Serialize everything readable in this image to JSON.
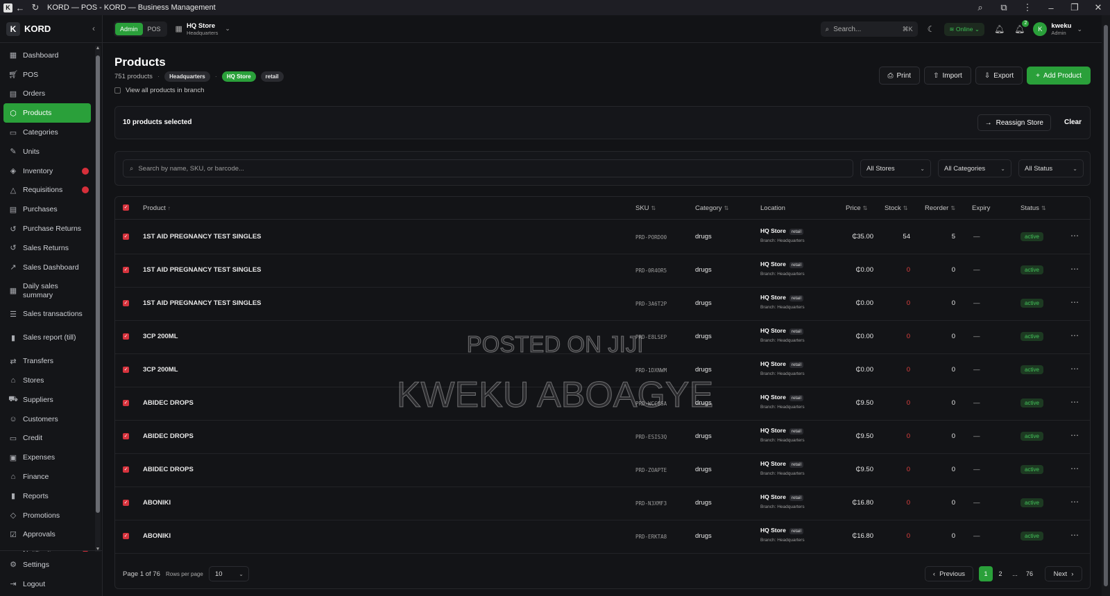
{
  "window": {
    "title": "KORD — POS - KORD — Business Management"
  },
  "brand": {
    "name": "KORD",
    "logo_letter": "K"
  },
  "sidebar": {
    "items": [
      {
        "label": "Dashboard",
        "icon": "grid-icon"
      },
      {
        "label": "POS",
        "icon": "cart-icon"
      },
      {
        "label": "Orders",
        "icon": "clipboard-icon"
      },
      {
        "label": "Products",
        "icon": "box-icon",
        "active": true
      },
      {
        "label": "Categories",
        "icon": "folder-icon"
      },
      {
        "label": "Units",
        "icon": "ruler-icon"
      },
      {
        "label": "Inventory",
        "icon": "layers-icon",
        "badge": true
      },
      {
        "label": "Requisitions",
        "icon": "alert-icon",
        "badge": true
      },
      {
        "label": "Purchases",
        "icon": "receipt-icon"
      },
      {
        "label": "Purchase Returns",
        "icon": "return-icon"
      },
      {
        "label": "Sales Returns",
        "icon": "return-icon"
      },
      {
        "label": "Sales Dashboard",
        "icon": "trend-icon"
      },
      {
        "label": "Daily sales summary",
        "icon": "calendar-icon"
      },
      {
        "label": "Sales transactions",
        "icon": "list-icon"
      },
      {
        "label": "Sales report (till)",
        "icon": "bar-chart-icon"
      },
      {
        "label": "Transfers",
        "icon": "swap-icon"
      },
      {
        "label": "Stores",
        "icon": "store-icon"
      },
      {
        "label": "Suppliers",
        "icon": "truck-icon"
      },
      {
        "label": "Customers",
        "icon": "users-icon"
      },
      {
        "label": "Credit",
        "icon": "card-icon"
      },
      {
        "label": "Expenses",
        "icon": "wallet-icon"
      },
      {
        "label": "Finance",
        "icon": "bank-icon"
      },
      {
        "label": "Reports",
        "icon": "bar-chart-icon"
      },
      {
        "label": "Promotions",
        "icon": "tag-icon"
      },
      {
        "label": "Approvals",
        "icon": "check-icon"
      },
      {
        "label": "Notifications",
        "icon": "bell-icon",
        "badge": true
      }
    ],
    "bottom": [
      {
        "label": "Settings",
        "icon": "gear-icon"
      },
      {
        "label": "Logout",
        "icon": "logout-icon"
      }
    ]
  },
  "header": {
    "mode_admin": "Admin",
    "mode_pos": "POS",
    "store_name": "HQ Store",
    "store_sub": "Headquarters",
    "search_placeholder": "Search...",
    "search_kbd": "⌘K",
    "online_label": "Online",
    "notif_count": "2",
    "user_initial": "K",
    "user_name": "kweku",
    "user_role": "Admin"
  },
  "page": {
    "title": "Products",
    "count_text": "751 products",
    "chip_branch": "Headquarters",
    "chip_store": "HQ Store",
    "chip_type": "retail",
    "view_all_label": "View all products in branch",
    "actions": {
      "print": "Print",
      "import": "Import",
      "export": "Export",
      "add": "Add Product"
    }
  },
  "selection": {
    "text": "10 products selected",
    "reassign": "Reassign Store",
    "clear": "Clear"
  },
  "filters": {
    "search_placeholder": "Search by name, SKU, or barcode...",
    "stores": "All Stores",
    "categories": "All Categories",
    "status": "All Status"
  },
  "table": {
    "headers": {
      "product": "Product",
      "sku": "SKU",
      "category": "Category",
      "location": "Location",
      "price": "Price",
      "stock": "Stock",
      "reorder": "Reorder",
      "expiry": "Expiry",
      "status": "Status"
    },
    "rows": [
      {
        "product": "1ST AID PREGNANCY TEST SINGLES",
        "sku": "PRD-PORDO0",
        "category": "drugs",
        "loc": "HQ Store",
        "tag": "retail",
        "branch": "Branch: Headquarters",
        "price": "₵35.00",
        "stock": "54",
        "reorder": "5",
        "expiry": "—",
        "status": "active"
      },
      {
        "product": "1ST AID PREGNANCY TEST SINGLES",
        "sku": "PRD-0R4OR5",
        "category": "drugs",
        "loc": "HQ Store",
        "tag": "retail",
        "branch": "Branch: Headquarters",
        "price": "₵0.00",
        "stock": "0",
        "reorder": "0",
        "expiry": "—",
        "status": "active"
      },
      {
        "product": "1ST AID PREGNANCY TEST SINGLES",
        "sku": "PRD-3A6T2P",
        "category": "drugs",
        "loc": "HQ Store",
        "tag": "retail",
        "branch": "Branch: Headquarters",
        "price": "₵0.00",
        "stock": "0",
        "reorder": "0",
        "expiry": "—",
        "status": "active"
      },
      {
        "product": "3CP 200ML",
        "sku": "PRD-E8LSEP",
        "category": "drugs",
        "loc": "HQ Store",
        "tag": "retail",
        "branch": "Branch: Headquarters",
        "price": "₵0.00",
        "stock": "0",
        "reorder": "0",
        "expiry": "—",
        "status": "active"
      },
      {
        "product": "3CP 200ML",
        "sku": "PRD-1DXNWM",
        "category": "drugs",
        "loc": "HQ Store",
        "tag": "retail",
        "branch": "Branch: Headquarters",
        "price": "₵0.00",
        "stock": "0",
        "reorder": "0",
        "expiry": "—",
        "status": "active"
      },
      {
        "product": "ABIDEC DROPS",
        "sku": "PRD-WCC8SA",
        "category": "drugs",
        "loc": "HQ Store",
        "tag": "retail",
        "branch": "Branch: Headquarters",
        "price": "₵9.50",
        "stock": "0",
        "reorder": "0",
        "expiry": "—",
        "status": "active"
      },
      {
        "product": "ABIDEC DROPS",
        "sku": "PRD-ESIS3Q",
        "category": "drugs",
        "loc": "HQ Store",
        "tag": "retail",
        "branch": "Branch: Headquarters",
        "price": "₵9.50",
        "stock": "0",
        "reorder": "0",
        "expiry": "—",
        "status": "active"
      },
      {
        "product": "ABIDEC DROPS",
        "sku": "PRD-ZOAPTE",
        "category": "drugs",
        "loc": "HQ Store",
        "tag": "retail",
        "branch": "Branch: Headquarters",
        "price": "₵9.50",
        "stock": "0",
        "reorder": "0",
        "expiry": "—",
        "status": "active"
      },
      {
        "product": "ABONIKI",
        "sku": "PRD-N3XMF3",
        "category": "drugs",
        "loc": "HQ Store",
        "tag": "retail",
        "branch": "Branch: Headquarters",
        "price": "₵16.80",
        "stock": "0",
        "reorder": "0",
        "expiry": "—",
        "status": "active"
      },
      {
        "product": "ABONIKI",
        "sku": "PRD-ERKTA8",
        "category": "drugs",
        "loc": "HQ Store",
        "tag": "retail",
        "branch": "Branch: Headquarters",
        "price": "₵16.80",
        "stock": "0",
        "reorder": "0",
        "expiry": "—",
        "status": "active"
      }
    ]
  },
  "pagination": {
    "info": "Page 1 of 76",
    "rpp_label": "Rows per page",
    "rpp_value": "10",
    "previous": "Previous",
    "pages": [
      "1",
      "2",
      "...",
      "76"
    ],
    "next": "Next"
  },
  "watermark": {
    "line1": "POSTED ON JIJI",
    "line2": "KWEKU ABOAGYE"
  },
  "colors": {
    "accent": "#2aa03a",
    "danger": "#d6333d",
    "background": "#121316"
  }
}
